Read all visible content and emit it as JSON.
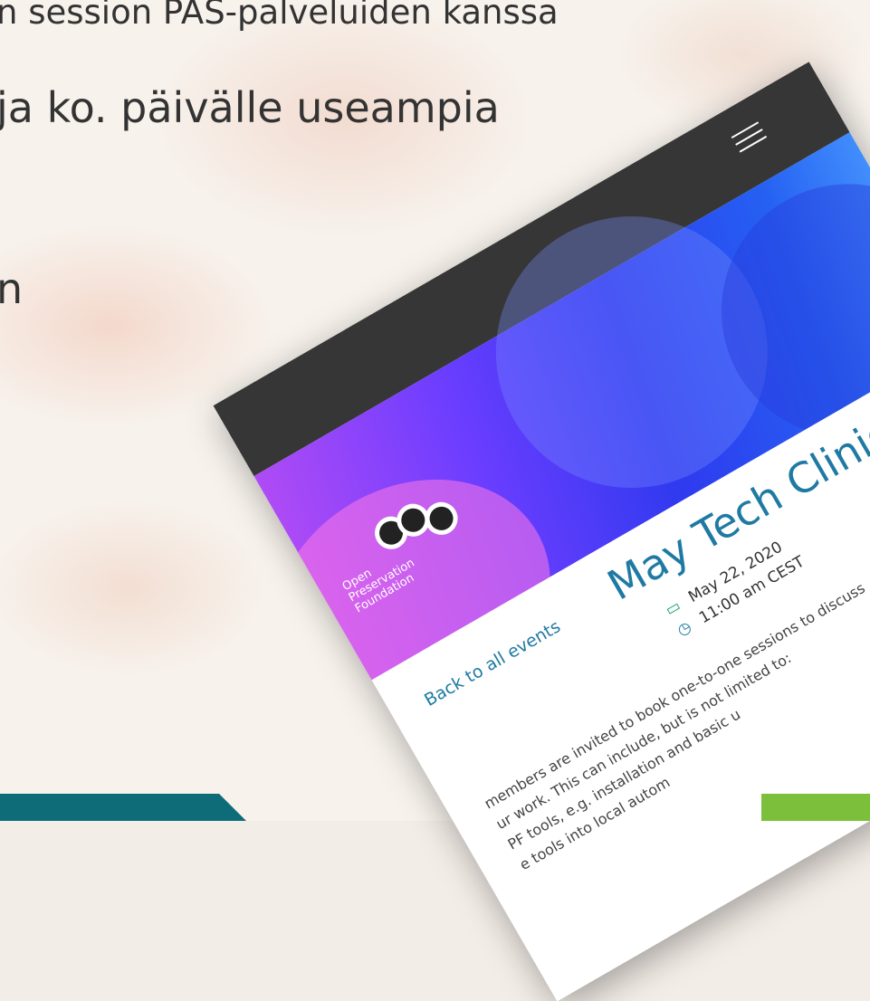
{
  "slide": {
    "line1": "n session PAS-palveluiden kanssa",
    "line2": "ja ko. päivälle useampia",
    "line3": "n"
  },
  "site": {
    "logo": {
      "line1": "Open",
      "line2": "Preservation",
      "line3": "Foundation"
    },
    "menu_icon": "hamburger-icon"
  },
  "event": {
    "back_link": "Back to all events",
    "title": "May Tech Clinic",
    "date": "May 22, 2020",
    "time": "11:00 am CEST",
    "body": [
      "members are invited to book one-to-one sessions to discuss",
      "ur work. This can include, but is not limited to:",
      "PF tools, e.g. installation and basic u",
      "e tools into local autom"
    ]
  },
  "colors": {
    "teal": "#0d6c78",
    "topbar": "#363636",
    "link": "#1f7aa3",
    "calendar": "#16a06a",
    "green": "#7bbf3a"
  }
}
